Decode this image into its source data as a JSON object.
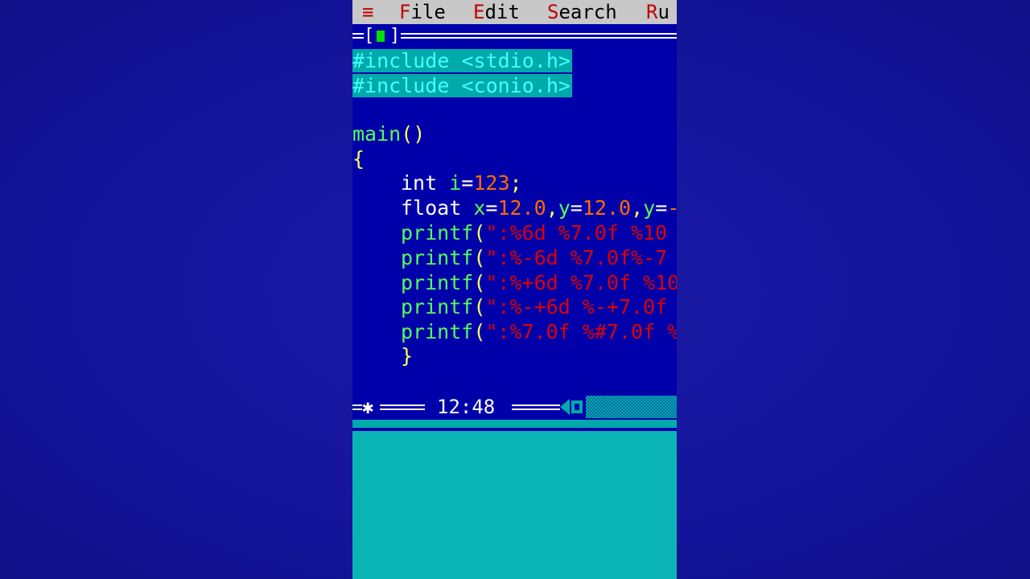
{
  "menu": {
    "system_icon": "≡",
    "items": [
      {
        "hot": "F",
        "rest": "ile"
      },
      {
        "hot": "E",
        "rest": "dit"
      },
      {
        "hot": "S",
        "rest": "earch"
      },
      {
        "hot": "R",
        "rest": "u"
      }
    ]
  },
  "window": {
    "bracket_left": "[",
    "bracket_right": "]"
  },
  "code": {
    "include1": "#include <stdio.h>",
    "include2": "#include <conio.h>",
    "main": "main",
    "main_parens": "()",
    "open_brace": "{",
    "int_kw": "int",
    "int_var": "i",
    "int_eq": "=",
    "int_val": "123",
    "int_semi": ";",
    "float_kw": "float",
    "float_x": "x",
    "float_eq1": "=",
    "float_xval": "12.0",
    "float_c1": ",",
    "float_y": "y",
    "float_eq2": "=",
    "float_yval": "12.0",
    "float_c2": ",",
    "float_y2": "y",
    "float_eq3": "=",
    "float_tail": "-",
    "printf_name": "printf",
    "printf_paren": "(",
    "printf_lines": [
      "\":%6d %7.0f %10",
      "\":%-6d %7.0f%-7",
      "\":%+6d %7.0f %10",
      "\":%-+6d %-+7.0f ",
      "\":%7.0f %#7.0f %"
    ],
    "close_brace": "}"
  },
  "status": {
    "star": "✱",
    "time": "12:48"
  },
  "colors": {
    "editor_bg": "#0000aa",
    "menu_bg": "#c8c8c8",
    "hotkey": "#c00000",
    "selection": "#00aaaa",
    "lower_panel": "#0bb4b4"
  }
}
